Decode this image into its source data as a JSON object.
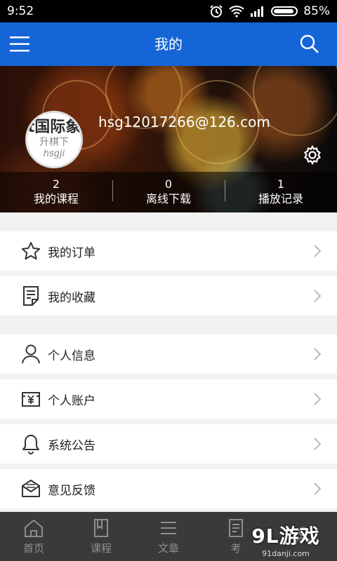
{
  "status_bar": {
    "time": "9:52",
    "battery": "85%"
  },
  "app_bar": {
    "title": "我的",
    "menu_icon": "hamburger-menu-icon",
    "search_icon": "search-icon"
  },
  "profile": {
    "avatar": {
      "line1": "t国际象",
      "line2": "升棋下",
      "line3": "hsgji"
    },
    "email": "hsg12017266@126.com",
    "stats": [
      {
        "value": "2",
        "label": "我的课程"
      },
      {
        "value": "0",
        "label": "离线下载"
      },
      {
        "value": "1",
        "label": "播放记录"
      }
    ]
  },
  "menu": [
    {
      "label": "我的订单",
      "icon": "star-icon"
    },
    {
      "label": "我的收藏",
      "icon": "note-icon"
    },
    {
      "label": "个人信息",
      "icon": "person-icon"
    },
    {
      "label": "个人账户",
      "icon": "yen-wallet-icon"
    },
    {
      "label": "系统公告",
      "icon": "bell-icon"
    },
    {
      "label": "意见反馈",
      "icon": "mail-icon"
    }
  ],
  "bottom_nav": [
    {
      "label": "首页",
      "icon": "home-icon"
    },
    {
      "label": "课程",
      "icon": "book-icon"
    },
    {
      "label": "文章",
      "icon": "list-icon"
    },
    {
      "label": "考",
      "icon": "exam-icon"
    },
    {
      "label": "",
      "icon": "profile-icon"
    }
  ],
  "watermark": {
    "logo": "9L游戏",
    "url": "91danji.com"
  },
  "colors": {
    "primary": "#1565d8",
    "nav_bg": "#3a3a3a"
  }
}
